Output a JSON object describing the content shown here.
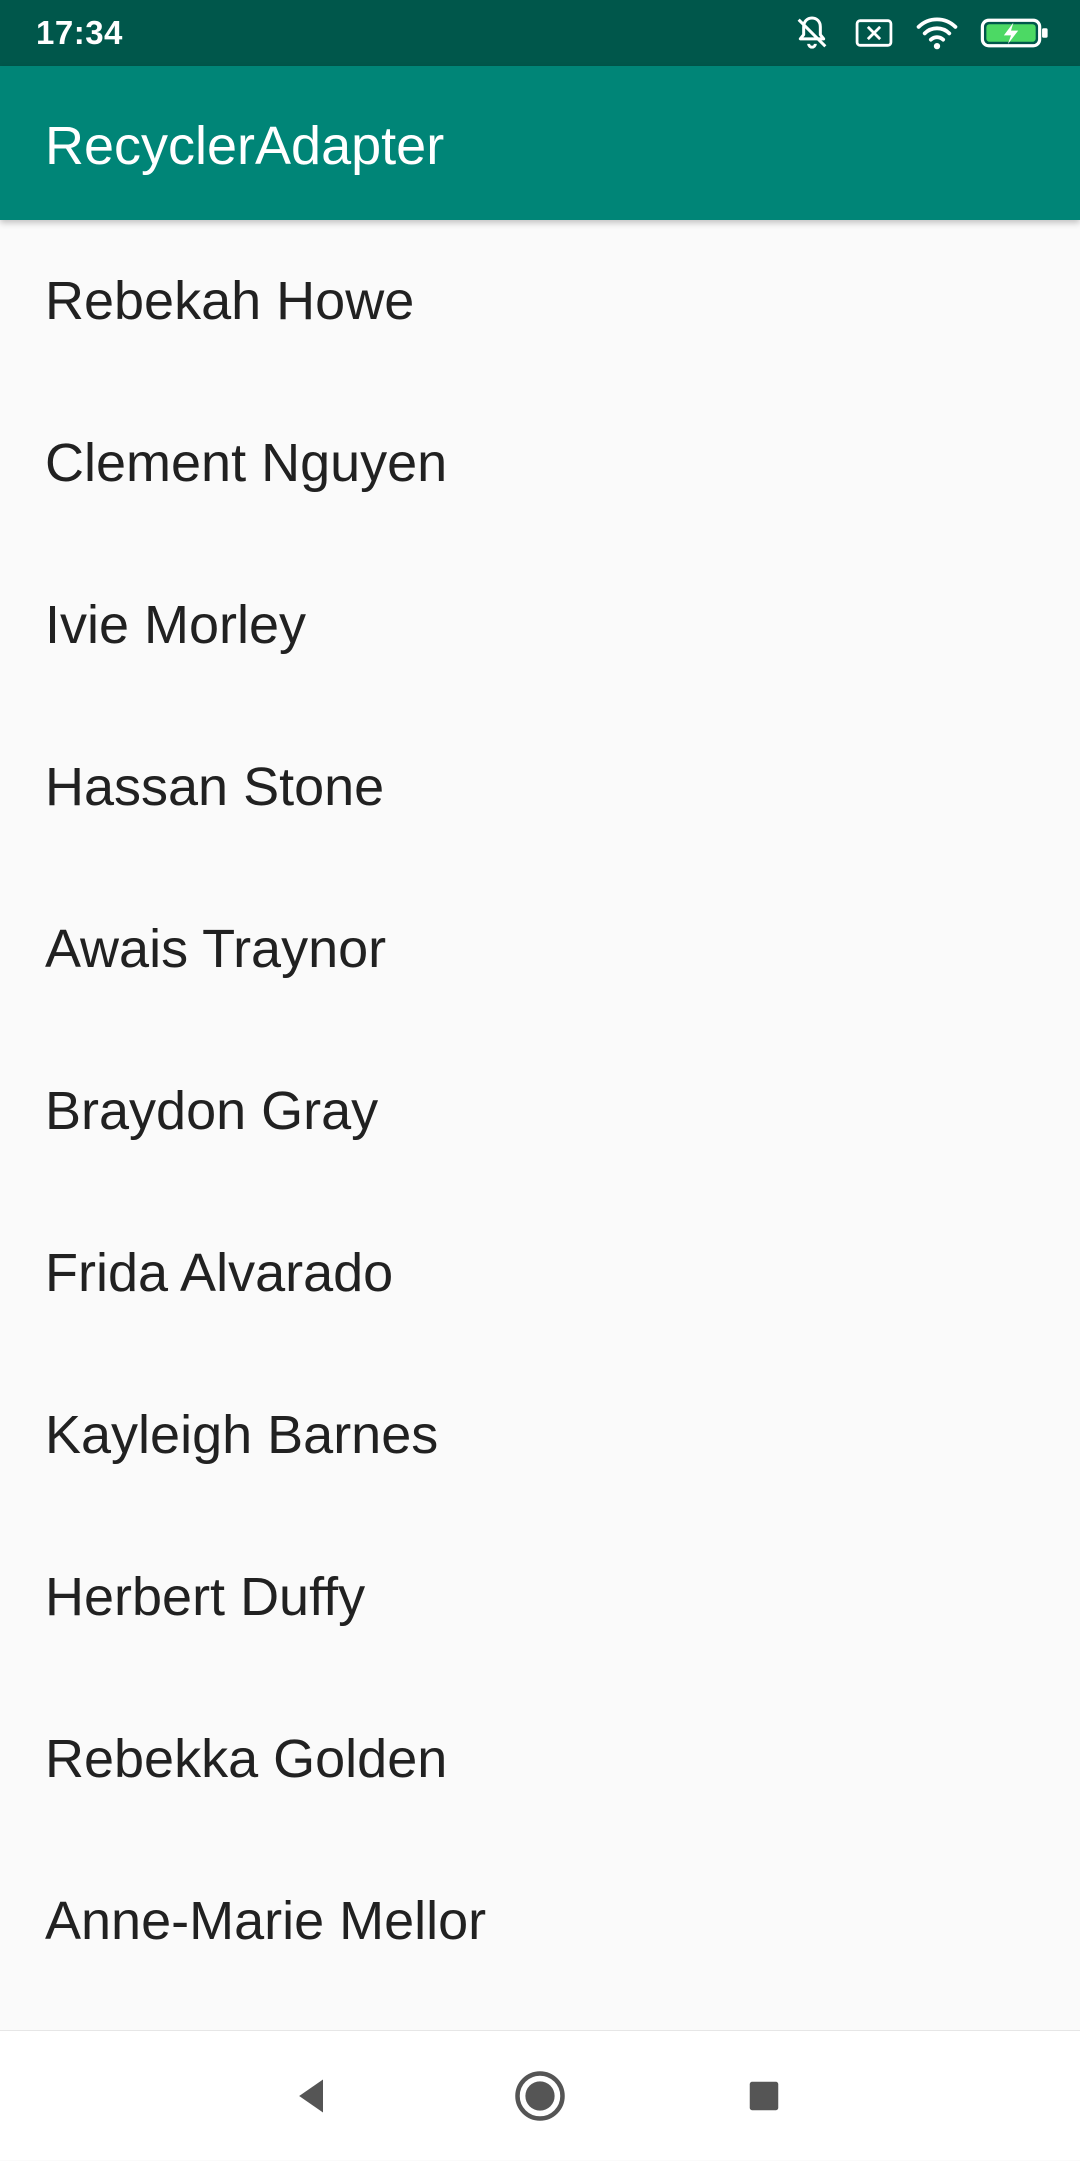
{
  "status_bar": {
    "time": "17:34",
    "icons": [
      "mute-icon",
      "no-sim-icon",
      "wifi-icon",
      "battery-charging-icon"
    ],
    "background_color": "#00574b"
  },
  "app_bar": {
    "title": "RecyclerAdapter",
    "background_color": "#008577"
  },
  "list": {
    "items": [
      "Rebekah Howe",
      "Clement Nguyen",
      "Ivie Morley",
      "Hassan Stone",
      "Awais Traynor",
      "Braydon Gray",
      "Frida Alvarado",
      "Kayleigh Barnes",
      "Herbert Duffy",
      "Rebekka Golden",
      "Anne-Marie Mellor"
    ],
    "text_color": "#212121",
    "background_color": "#fafafa"
  },
  "nav_bar": {
    "buttons": [
      "back-icon",
      "home-icon",
      "recents-icon"
    ]
  }
}
